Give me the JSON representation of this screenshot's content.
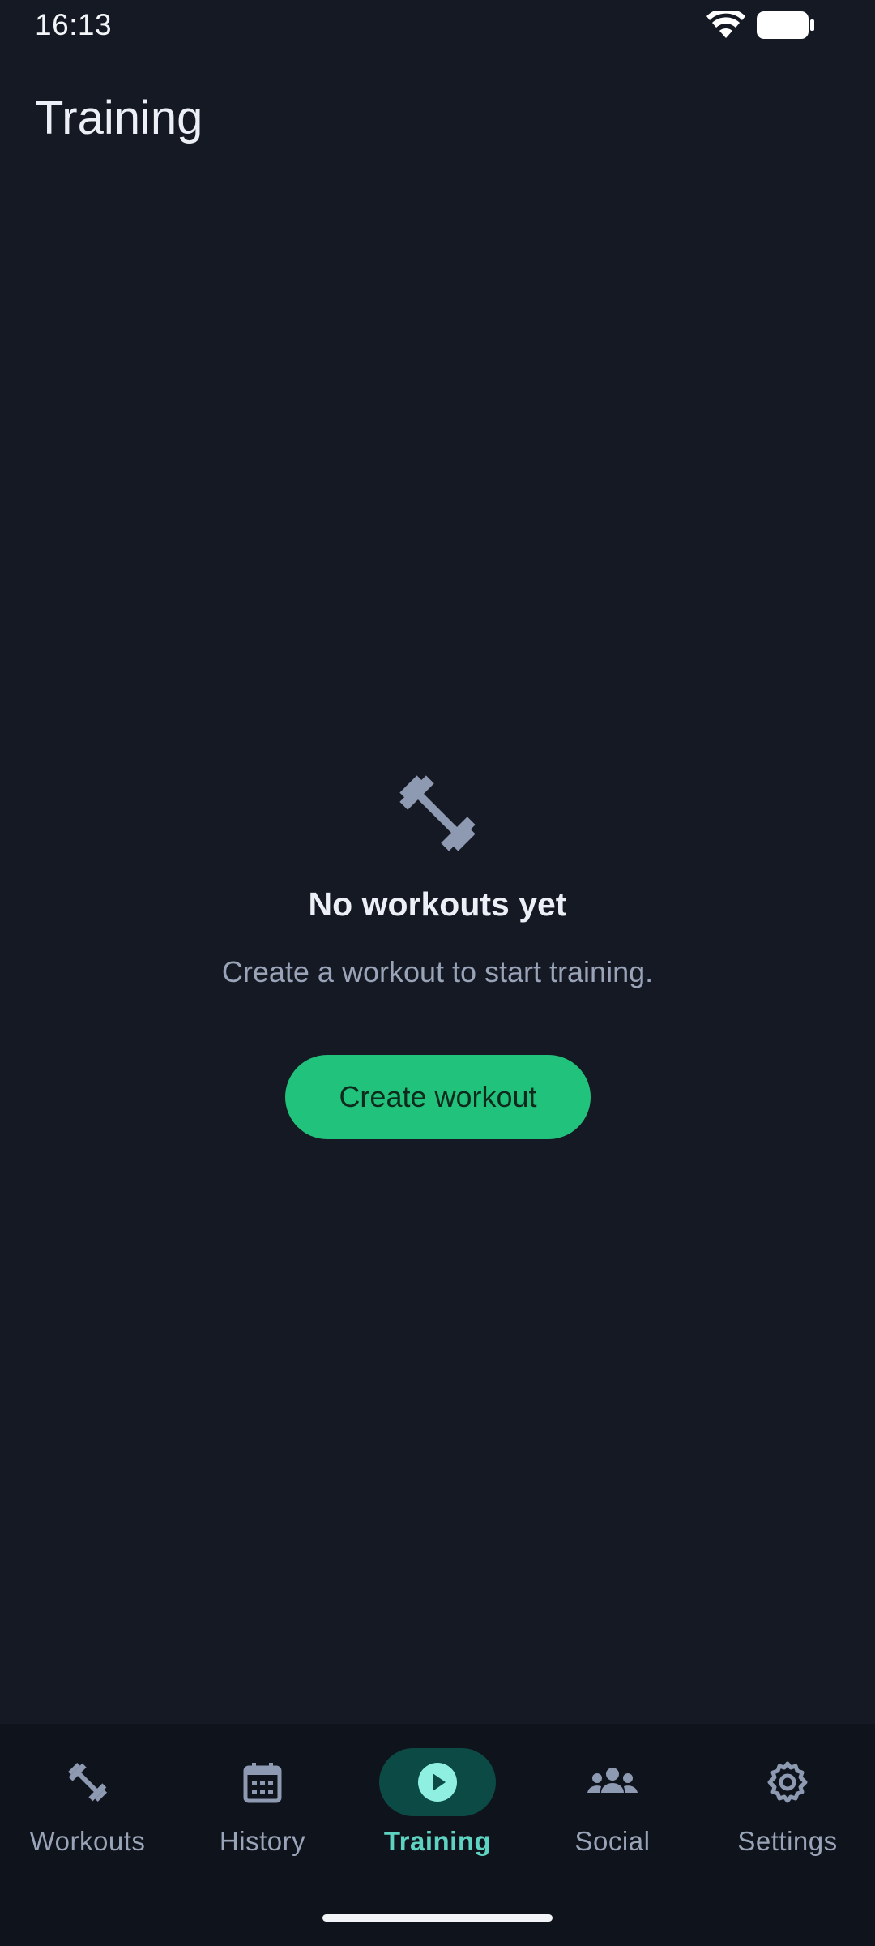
{
  "status_bar": {
    "time": "16:13",
    "icons": [
      "wifi-icon",
      "battery-icon"
    ]
  },
  "header": {
    "title": "Training"
  },
  "empty_state": {
    "icon": "barbell-icon",
    "title": "No workouts yet",
    "subtitle": "Create a workout to start training.",
    "button_label": "Create workout"
  },
  "bottom_nav": {
    "active_index": 2,
    "items": [
      {
        "label": "Workouts",
        "icon": "barbell-icon"
      },
      {
        "label": "History",
        "icon": "calendar-icon"
      },
      {
        "label": "Training",
        "icon": "play-icon"
      },
      {
        "label": "Social",
        "icon": "group-icon"
      },
      {
        "label": "Settings",
        "icon": "gear-icon"
      }
    ]
  },
  "colors": {
    "background": "#151923",
    "nav_background": "#0f131b",
    "accent": "#21c27b",
    "active_nav": "#5fd3c2",
    "active_pill": "#0c4a45",
    "muted_text": "#9aa4b8"
  }
}
